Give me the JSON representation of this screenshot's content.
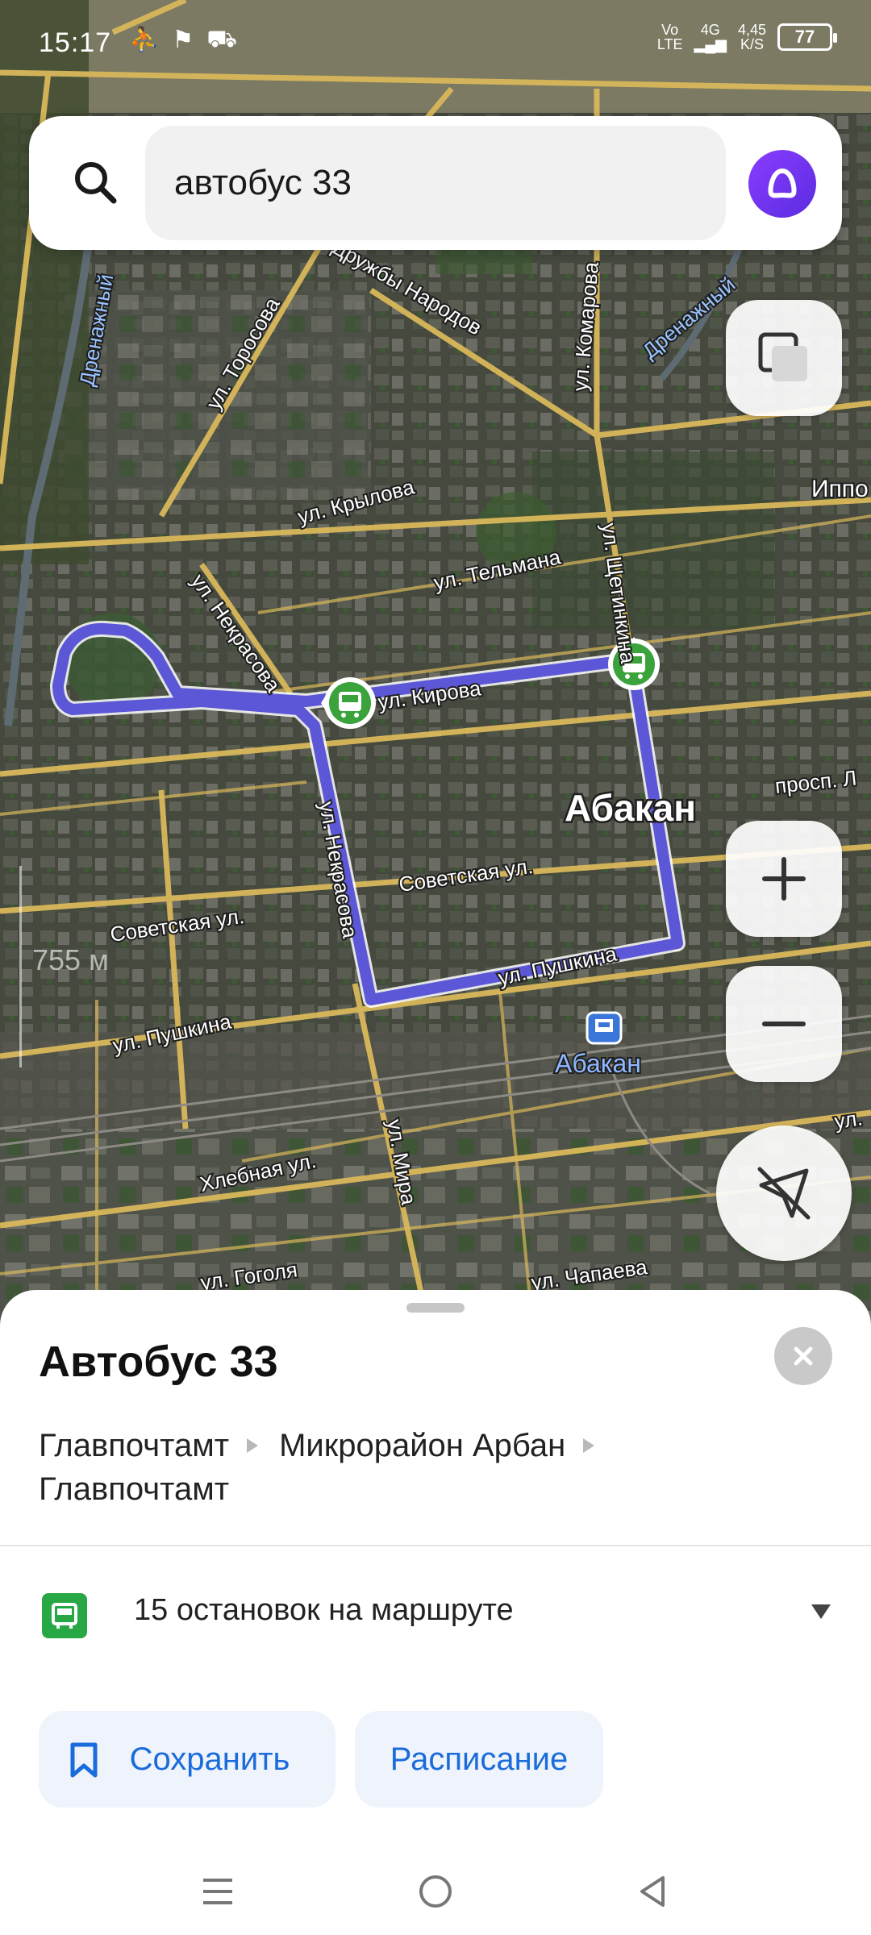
{
  "status_bar": {
    "time": "15:17",
    "network_label_1": "Vo",
    "network_label_2": "LTE",
    "signal_label": "4G",
    "speed_value": "4,45",
    "speed_unit": "K/S",
    "battery": "77"
  },
  "search": {
    "query": "автобус 33",
    "icon": "search-icon",
    "assistant_icon": "alice-icon"
  },
  "map": {
    "city_label": "Абакан",
    "station_label": "Абакан",
    "scale": "755 м",
    "streets": [
      "Дружбы Народов",
      "ул. Торосова",
      "ул. Комарова",
      "Дренажный",
      "Дренажный",
      "ул. Крылова",
      "ул. Тельмана",
      "ул. Некрасова",
      "ул. Щетинкина",
      "ул. Кирова",
      "ул. Некрасова",
      "Советская ул.",
      "Советская ул.",
      "ул. Пушкина",
      "ул. Пушкина",
      "ул. Мира",
      "Хлебная ул.",
      "ул. Гоголя",
      "ул. Чапаева",
      "просп. Л",
      "Иппо",
      "ул."
    ],
    "route_color": "#5b57d6"
  },
  "controls": {
    "layers": "layers-icon",
    "zoom_in": "plus-icon",
    "zoom_out": "minus-icon",
    "locate": "location-off-icon"
  },
  "sheet": {
    "title": "Автобус 33",
    "stops_path": [
      "Главпочтамт",
      "Микрорайон Арбан",
      "Главпочтамт"
    ],
    "stops_count": "15 остановок на маршруте",
    "save_label": "Сохранить",
    "schedule_label": "Расписание"
  }
}
